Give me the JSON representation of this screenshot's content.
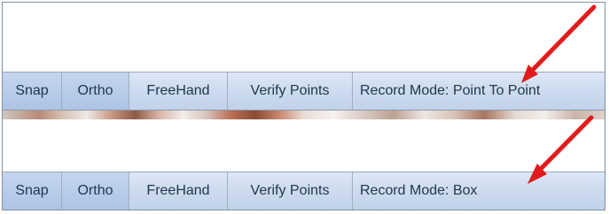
{
  "toolbars": [
    {
      "buttons": {
        "snap": "Snap",
        "ortho": "Ortho",
        "freehand": "FreeHand",
        "verify_points": "Verify Points",
        "record_mode": "Record Mode: Point To Point"
      }
    },
    {
      "buttons": {
        "snap": "Snap",
        "ortho": "Ortho",
        "freehand": "FreeHand",
        "verify_points": "Verify Points",
        "record_mode": "Record Mode: Box"
      }
    }
  ],
  "colors": {
    "annotation_arrow": "#e11b1b",
    "toolbar_bg": "#cfdcef",
    "toolbar_text": "#1f3550",
    "frame_border": "#7f8fa3"
  },
  "icons": {
    "annotation": "red-arrow"
  }
}
